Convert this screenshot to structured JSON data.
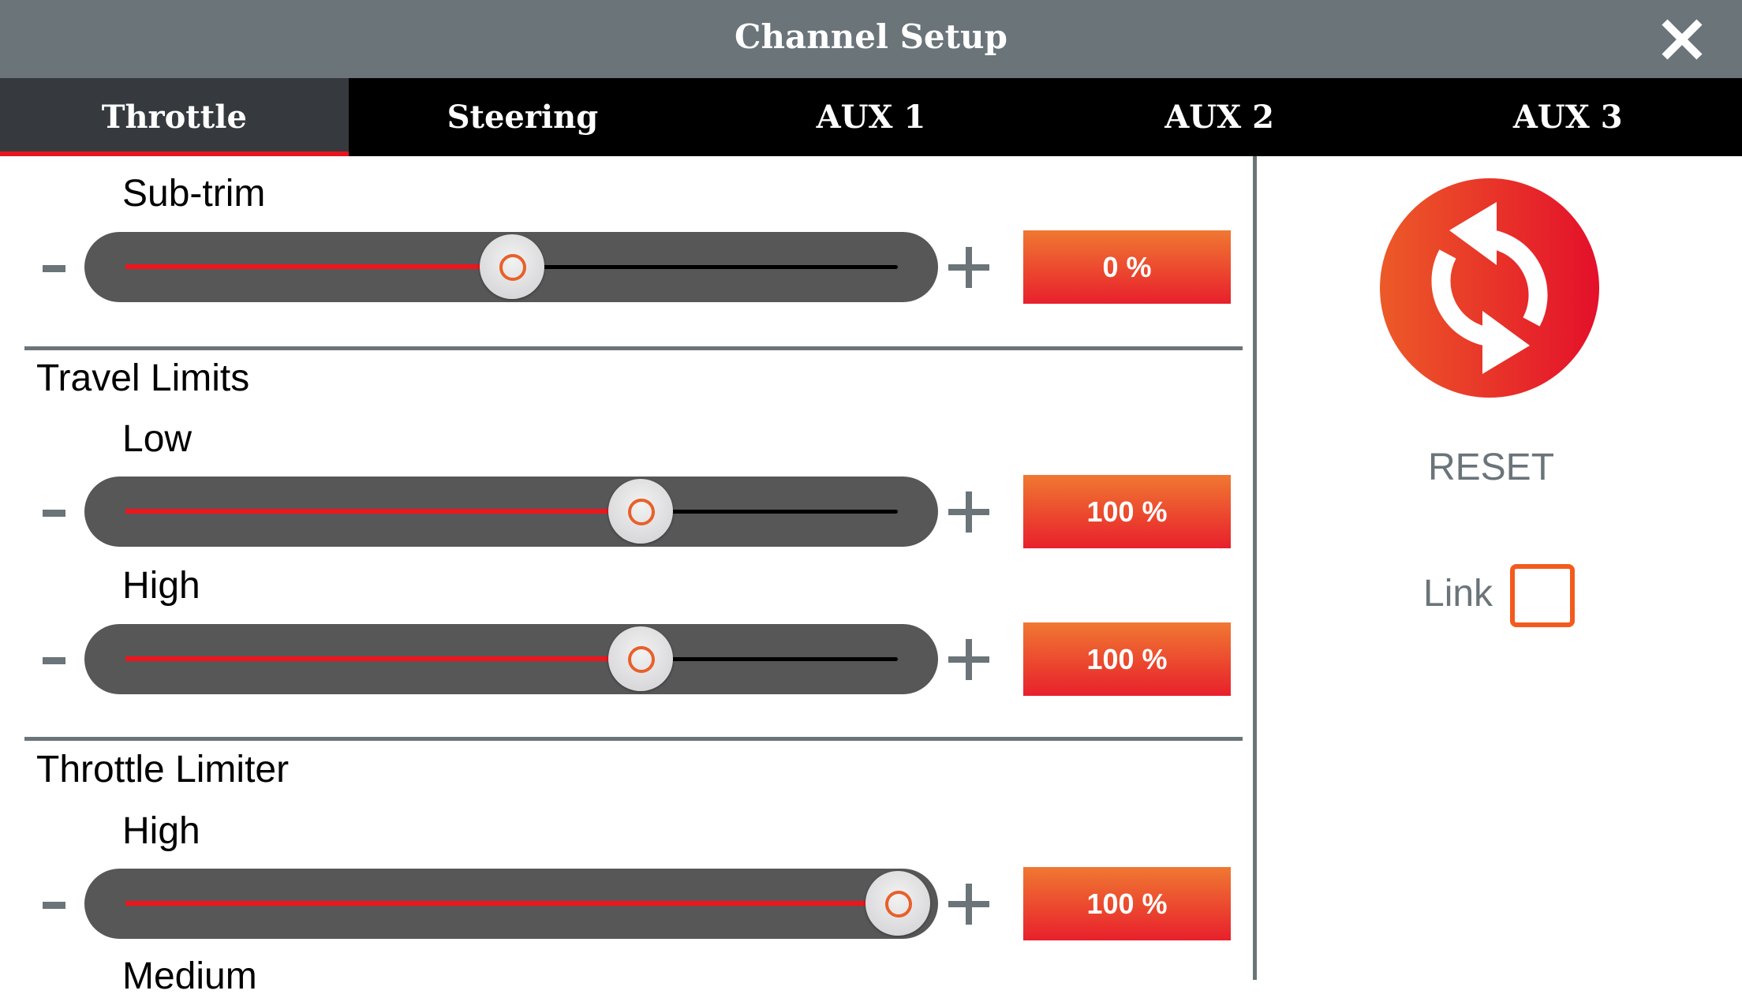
{
  "header": {
    "title": "Channel Setup",
    "close_icon": "close-x-icon"
  },
  "tabs": [
    {
      "label": "Throttle",
      "active": true
    },
    {
      "label": "Steering",
      "active": false
    },
    {
      "label": "AUX 1",
      "active": false
    },
    {
      "label": "AUX 2",
      "active": false
    },
    {
      "label": "AUX 3",
      "active": false
    }
  ],
  "colors": {
    "header_bg": "#6a7479",
    "accent_red": "#e8141c",
    "badge_top": "#f07832",
    "badge_bottom": "#e8202c",
    "checkbox_orange": "#f45a1c"
  },
  "sections": {
    "subtrim": {
      "label": "Sub-trim",
      "value_text": "0 %",
      "value": 0,
      "min": -100,
      "max": 100
    },
    "travel_limits": {
      "title": "Travel Limits",
      "low": {
        "label": "Low",
        "value_text": "100 %",
        "value": 100,
        "min": 0,
        "max": 150
      },
      "high": {
        "label": "High",
        "value_text": "100 %",
        "value": 100,
        "min": 0,
        "max": 150
      }
    },
    "throttle_limiter": {
      "title": "Throttle Limiter",
      "high": {
        "label": "High",
        "value_text": "100 %",
        "value": 100,
        "min": 0,
        "max": 100
      },
      "medium": {
        "label": "Medium"
      }
    }
  },
  "controls": {
    "minus_symbol": "-",
    "plus_symbol": "+"
  },
  "sidebar": {
    "reset_label": "RESET",
    "reset_icon": "refresh-arrows-icon",
    "link_label": "Link",
    "link_checked": false
  }
}
